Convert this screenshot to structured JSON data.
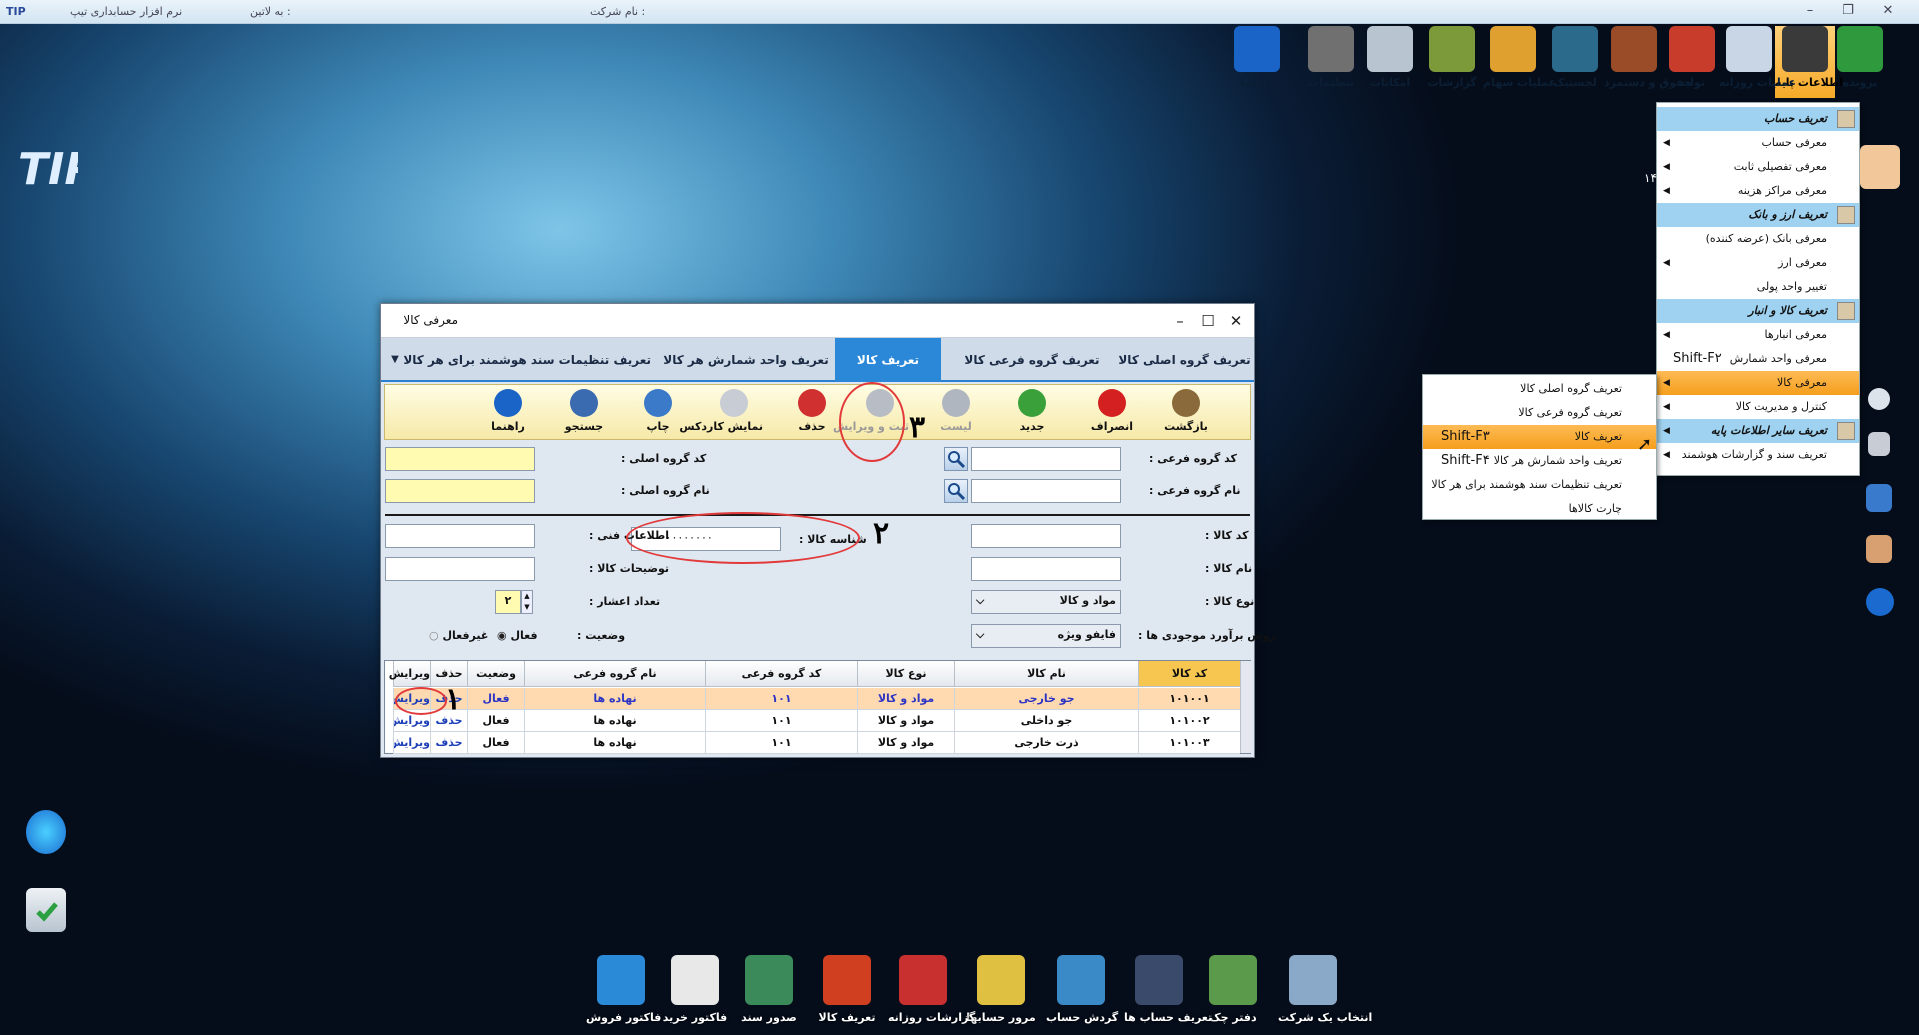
{
  "titlebar": {
    "app": "نرم افزار حسابداری تیپ",
    "latin": "به لاتین :",
    "company": "نام شرکت :",
    "logo": "TIP"
  },
  "toolbar": [
    {
      "label": "پرونده",
      "color": "#2f9a3d"
    },
    {
      "label": "اطلاعات پایه",
      "color": "#3a3a3a"
    },
    {
      "label": "عملیات روزانه",
      "color": "#c8d6e6"
    },
    {
      "label": "تولید",
      "color": "#c83c2c"
    },
    {
      "label": "حقوق و دستمزد",
      "color": "#9a4b28"
    },
    {
      "label": "لجستیک",
      "color": "#2b6a8a"
    },
    {
      "label": "عملیات سهام",
      "color": "#e0a030"
    },
    {
      "label": "گزارشات",
      "color": "#7c9a3a"
    },
    {
      "label": "امکانات",
      "color": "#b8c4d0"
    },
    {
      "label": "تنظیمات",
      "color": "#707070"
    },
    {
      "label": "راهنما",
      "color": "#1a64c8"
    }
  ],
  "menu": {
    "items": [
      {
        "label": "تعریف حساب",
        "type": "header"
      },
      {
        "label": "معرفی حساب",
        "type": "item",
        "arrow": true
      },
      {
        "label": "معرفی تفصیلی ثابت",
        "type": "item",
        "arrow": true
      },
      {
        "label": "معرفی مراکز هزینه",
        "type": "item",
        "arrow": true
      },
      {
        "label": "تعریف ارز و بانک",
        "type": "header"
      },
      {
        "label": "معرفی بانک (عرضه کننده)",
        "type": "item",
        "arrow": false
      },
      {
        "label": "معرفی ارز",
        "type": "item",
        "arrow": true
      },
      {
        "label": "تغییر واحد پولی",
        "type": "item",
        "arrow": false
      },
      {
        "label": "تعریف کالا و انبار",
        "type": "header"
      },
      {
        "label": "معرفی انبارها",
        "type": "item",
        "arrow": true
      },
      {
        "label": "معرفی واحد شمارش",
        "type": "item",
        "arrow": false,
        "shortcut": "Shift-F۲"
      },
      {
        "label": "معرفی کالا",
        "type": "selected",
        "arrow": true
      },
      {
        "label": "کنترل و مدیریت کالا",
        "type": "item",
        "arrow": true
      },
      {
        "label": "تعریف سایر اطلاعات پایه",
        "type": "header",
        "arrow": true
      },
      {
        "label": "تعریف سند و گزارشات هوشمند",
        "type": "item",
        "arrow": true
      }
    ],
    "extra_number": "۱۴"
  },
  "submenu": {
    "items": [
      {
        "label": "تعریف گروه اصلی کالا",
        "shortcut": ""
      },
      {
        "label": "تعریف گروه فرعی کالا",
        "shortcut": ""
      },
      {
        "label": "تعریف کالا",
        "shortcut": "Shift-F۳",
        "selected": true
      },
      {
        "label": "تعریف واحد شمارش هر کالا",
        "shortcut": "Shift-F۴"
      },
      {
        "label": "تعریف تنظیمات سند هوشمند برای هر کالا",
        "shortcut": ""
      },
      {
        "label": "چارت کالاها",
        "shortcut": ""
      }
    ]
  },
  "dialog": {
    "title": "معرفی کالا",
    "tabs": [
      "تعریف گروه اصلی کالا",
      "تعریف گروه فرعی کالا",
      "تعریف کالا",
      "تعریف واحد شمارش هر کالا",
      "تعریف تنظیمات سند هوشمند برای هر کالا"
    ],
    "tools": [
      {
        "label": "بازگشت",
        "icon": "home-icon",
        "color": "#8a6a3a"
      },
      {
        "label": "انصراف",
        "icon": "cancel-icon",
        "color": "#d42020"
      },
      {
        "label": "جدید",
        "icon": "new-icon",
        "color": "#3aa03a"
      },
      {
        "label": "لیست",
        "icon": "list-icon",
        "color": "#b0b6c0"
      },
      {
        "label": "ثبت و ویرایش",
        "icon": "save-edit-icon",
        "color": "#b8bcc4"
      },
      {
        "label": "حذف",
        "icon": "delete-icon",
        "color": "#d03030"
      },
      {
        "label": "نمایش کاردکس",
        "icon": "cardex-icon",
        "color": "#c8ccd4"
      },
      {
        "label": "چاپ",
        "icon": "print-icon",
        "color": "#3a7ac8"
      },
      {
        "label": "جستجو",
        "icon": "search-icon",
        "color": "#3a6ab0"
      },
      {
        "label": "راهنما",
        "icon": "help-icon",
        "color": "#1a64c8"
      }
    ],
    "form": {
      "sub_group_code": "کد گروه فرعی :",
      "sub_group_name": "نام گروه فرعی :",
      "main_group_code": "کد گروه اصلی :",
      "main_group_name": "نام گروه اصلی :",
      "item_code": "کد کالا :",
      "item_name": "نام کالا :",
      "item_type": "نوع کالا :",
      "item_type_value": "مواد و کالا",
      "stock_method": "روش برآورد موجودی ها :",
      "stock_method_value": "فایفو ویژه",
      "item_id": "شناسه کالا :",
      "item_id_value": "۰۰۰۰۰۰۰۰۰۰۰۰۰",
      "tech_info": "اطلاعات فنی :",
      "description": "توضیحات کالا :",
      "decimals": "تعداد اعشار :",
      "decimals_value": "۲",
      "status": "وضعیت :",
      "active": "فعال",
      "inactive": "غیرفعال"
    },
    "grid": {
      "headers": [
        "کد کالا",
        "نام کالا",
        "نوع کالا",
        "کد گروه فرعی",
        "نام گروه فرعی",
        "وضعیت",
        "حذف",
        "ویرایش"
      ],
      "rows": [
        [
          "۱۰۱۰۰۱",
          "جو خارجی",
          "مواد و کالا",
          "۱۰۱",
          "نهاده ها",
          "فعال",
          "حذف",
          "ویرایش"
        ],
        [
          "۱۰۱۰۰۲",
          "جو داخلی",
          "مواد و کالا",
          "۱۰۱",
          "نهاده ها",
          "فعال",
          "حذف",
          "ویرایش"
        ],
        [
          "۱۰۱۰۰۳",
          "ذرت خارجی",
          "مواد و کالا",
          "۱۰۱",
          "نهاده ها",
          "فعال",
          "حذف",
          "ویرایش"
        ]
      ]
    },
    "annotations": [
      "۱",
      "۲",
      "۳"
    ]
  },
  "dock": [
    {
      "label": "انتخاب یک شرکت",
      "color": "#8aa8c8"
    },
    {
      "label": "دفتر چک",
      "color": "#5a9a4a"
    },
    {
      "label": "تعریف حساب ها",
      "color": "#3a4a6a"
    },
    {
      "label": "گردش حساب",
      "color": "#3a8ac8"
    },
    {
      "label": "مرور حسابها",
      "color": "#e0c040"
    },
    {
      "label": "گزارشات روزانه",
      "color": "#c83030"
    },
    {
      "label": "تعریف کالا",
      "color": "#d04020"
    },
    {
      "label": "صدور سند",
      "color": "#3a8a5a"
    },
    {
      "label": "فاکتور خرید",
      "color": "#e8e8e8"
    },
    {
      "label": "فاکتور فروش",
      "color": "#2a8ad8"
    }
  ]
}
